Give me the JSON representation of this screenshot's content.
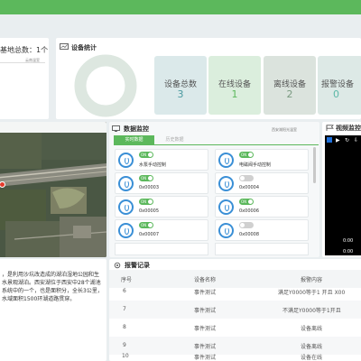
{
  "base_info": {
    "label": "基地总数：1个",
    "tag": "云南温室"
  },
  "stats": {
    "title": "设备统计",
    "boxes": [
      {
        "label": "设备总数",
        "value": "3",
        "color": "#dbe9ea"
      },
      {
        "label": "在线设备",
        "value": "1",
        "color": "#dbeedd"
      },
      {
        "label": "离线设备",
        "value": "2",
        "color": "#dbe3dd"
      },
      {
        "label": "报警设备",
        "value": "0",
        "color": "#dde9e6"
      }
    ]
  },
  "monitor": {
    "title": "数据监控",
    "location": "西安湖阳光温室",
    "tabs": [
      "实时数据",
      "历史数据"
    ],
    "toggle_on": "ON",
    "controls": [
      {
        "name": "水泵手动控制",
        "state": "on"
      },
      {
        "name": "电磁阀手动控制",
        "state": "on"
      },
      {
        "name": "0x00003",
        "state": "on"
      },
      {
        "name": "0x00004",
        "state": "off"
      },
      {
        "name": "0x00005",
        "state": "on"
      },
      {
        "name": "0x00006",
        "state": "on"
      },
      {
        "name": "0x00007",
        "state": "on"
      },
      {
        "name": "0x00008",
        "state": "off"
      }
    ]
  },
  "video": {
    "title": "视频监控",
    "time": "0:00",
    "time2": "0:00"
  },
  "description": {
    "text": "，是利用沙坑改造成的湖泊湿地公园和生水景观湖泊。西安湖位于西安中28个湖池系统中的一个，也是面积分，全长3公里，水域面积1500环湖道路贯穿。"
  },
  "alarm": {
    "title": "报警记录",
    "columns": [
      "序号",
      "设备名称",
      "报警内容"
    ],
    "rows": [
      {
        "id": "6",
        "device": "事件测试",
        "content": "满足Y0000等于1 开且 X00"
      },
      {
        "id": "7",
        "device": "事件测试",
        "content": "不满足Y0000等于1开且"
      },
      {
        "id": "8",
        "device": "事件测试",
        "content": "设备离线"
      },
      {
        "id": "9",
        "device": "事件测试",
        "content": "设备离线"
      },
      {
        "id": "10",
        "device": "事件测试",
        "content": "设备在线"
      }
    ]
  }
}
